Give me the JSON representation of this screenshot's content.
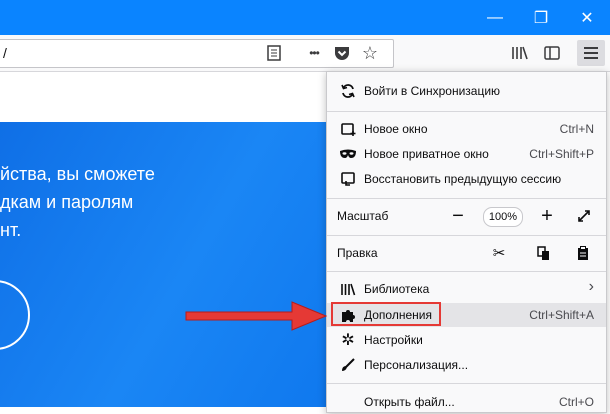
{
  "window": {
    "minimize": "—",
    "restore": "❐",
    "close": "✕"
  },
  "toolbar": {
    "url_text": "/",
    "reader_icon": "reader-mode-icon",
    "more_label": "•••",
    "pocket_icon": "pocket-icon",
    "bookmark_icon": "star-icon",
    "library_icon": "library-icon",
    "sidebar_icon": "sidebar-icon",
    "menu_icon": "hamburger-menu-icon"
  },
  "page": {
    "hero_lines": [
      "йства, вы сможете",
      "дкам и паролям",
      "нт."
    ]
  },
  "menu": {
    "sync": "Войти в Синхронизацию",
    "new_window": "Новое окно",
    "new_window_shortcut": "Ctrl+N",
    "private_window": "Новое приватное окно",
    "private_window_shortcut": "Ctrl+Shift+P",
    "restore_session": "Восстановить предыдущую сессию",
    "zoom_label": "Масштаб",
    "zoom_minus": "−",
    "zoom_value": "100%",
    "zoom_plus": "+",
    "edit_label": "Правка",
    "library": "Библиотека",
    "library_arrow": "›",
    "addons": "Дополнения",
    "addons_shortcut": "Ctrl+Shift+A",
    "settings": "Настройки",
    "customize": "Персонализация...",
    "open_file": "Открыть файл...",
    "open_file_shortcut": "Ctrl+O"
  },
  "colors": {
    "titlebar": "#0a84ff",
    "annotation": "#e53935"
  }
}
